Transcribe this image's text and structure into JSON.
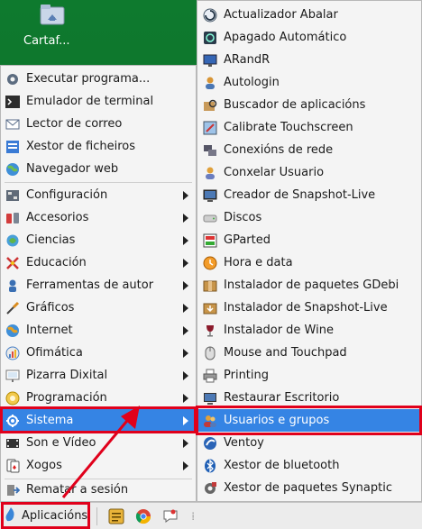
{
  "desktop": {
    "icon_label": "Cartaf..."
  },
  "menu": {
    "top_items": [
      {
        "label": "Executar programa...",
        "icon": "gear-run-icon"
      },
      {
        "label": "Emulador de terminal",
        "icon": "terminal-icon"
      },
      {
        "label": "Lector de correo",
        "icon": "mail-icon"
      },
      {
        "label": "Xestor de ficheiros",
        "icon": "file-manager-icon"
      },
      {
        "label": "Navegador web",
        "icon": "globe-icon"
      }
    ],
    "categories": [
      {
        "label": "Configuración",
        "icon": "settings-icon"
      },
      {
        "label": "Accesorios",
        "icon": "accessories-icon"
      },
      {
        "label": "Ciencias",
        "icon": "science-icon"
      },
      {
        "label": "Educación",
        "icon": "education-icon"
      },
      {
        "label": "Ferramentas de autor",
        "icon": "authoring-icon"
      },
      {
        "label": "Gráficos",
        "icon": "graphics-icon"
      },
      {
        "label": "Internet",
        "icon": "internet-icon"
      },
      {
        "label": "Ofimática",
        "icon": "office-icon"
      },
      {
        "label": "Pizarra Dixital",
        "icon": "whiteboard-icon"
      },
      {
        "label": "Programación",
        "icon": "programming-icon"
      },
      {
        "label": "Sistema",
        "icon": "system-icon"
      },
      {
        "label": "Son e Vídeo",
        "icon": "multimedia-icon"
      },
      {
        "label": "Xogos",
        "icon": "games-icon"
      }
    ],
    "logout_label": "Rematar a sesión",
    "active_category": "Sistema"
  },
  "submenu": {
    "items": [
      {
        "label": "Actualizador Abalar",
        "icon": "update-icon"
      },
      {
        "label": "Apagado Automático",
        "icon": "power-icon"
      },
      {
        "label": "ARandR",
        "icon": "display-icon"
      },
      {
        "label": "Autologin",
        "icon": "autologin-icon"
      },
      {
        "label": "Buscador de aplicacións",
        "icon": "package-search-icon"
      },
      {
        "label": "Calibrate Touchscreen",
        "icon": "touchscreen-icon"
      },
      {
        "label": "Conexións de rede",
        "icon": "network-icon"
      },
      {
        "label": "Conxelar Usuario",
        "icon": "freeze-user-icon"
      },
      {
        "label": "Creador de Snapshot-Live",
        "icon": "snapshot-icon"
      },
      {
        "label": "Discos",
        "icon": "disk-icon"
      },
      {
        "label": "GParted",
        "icon": "gparted-icon"
      },
      {
        "label": "Hora e data",
        "icon": "clock-icon"
      },
      {
        "label": "Instalador de paquetes GDebi",
        "icon": "gdebi-icon"
      },
      {
        "label": "Instalador de Snapshot-Live",
        "icon": "snapshot-install-icon"
      },
      {
        "label": "Instalador de Wine",
        "icon": "wine-icon"
      },
      {
        "label": "Mouse and Touchpad",
        "icon": "mouse-icon"
      },
      {
        "label": "Printing",
        "icon": "printer-icon"
      },
      {
        "label": "Restaurar Escritorio",
        "icon": "restore-desktop-icon"
      },
      {
        "label": "Usuarios e grupos",
        "icon": "users-groups-icon"
      },
      {
        "label": "Ventoy",
        "icon": "ventoy-icon"
      },
      {
        "label": "Xestor de bluetooth",
        "icon": "bluetooth-icon"
      },
      {
        "label": "Xestor de paquetes Synaptic",
        "icon": "synaptic-icon"
      }
    ],
    "active_item": "Usuarios e grupos"
  },
  "taskbar": {
    "apps_button_label": "Aplicacións",
    "launchers": [
      "notes-icon",
      "chrome-icon",
      "chat-icon"
    ]
  },
  "colors": {
    "highlight": "#3584e4",
    "annotation_red": "#e0001b",
    "desktop_green": "#0e7a2e"
  }
}
